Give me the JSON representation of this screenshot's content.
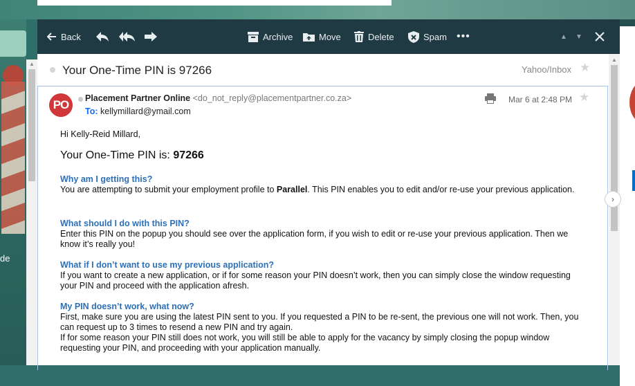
{
  "background": {
    "left_text": "de"
  },
  "toolbar": {
    "back": "Back",
    "archive": "Archive",
    "move": "Move",
    "delete": "Delete",
    "spam": "Spam",
    "more": "•••",
    "prev_arrow": "▲",
    "next_arrow": "▼"
  },
  "email": {
    "subject": "Your One-Time PIN is 97266",
    "folder": "Yahoo/Inbox",
    "avatar_initials": "PO",
    "sender_name": "Placement Partner Online",
    "sender_address": "<do_not_reply@placementpartner.co.za>",
    "to_label": "To:",
    "to_address": "kellymillard@ymail.com",
    "date": "Mar 6 at 2:48 PM",
    "greeting": "Hi Kelly-Reid Millard,",
    "pin_prefix": "Your One-Time PIN is:",
    "pin_value": "97266",
    "sections": [
      {
        "heading": "Why am I getting this?",
        "text_before": "You are attempting to submit your employment profile to ",
        "text_bold": "Parallel",
        "text_after": ". This PIN enables you to edit and/or re-use your previous application."
      },
      {
        "heading": "What should I do with this PIN?",
        "text": "Enter this PIN on the popup you should see over the application form, if you wish to edit or re-use your previous application. Then we know it’s really you!"
      },
      {
        "heading": "What if I don’t want to use my previous application?",
        "text": "If you want to create a new application, or if for some reason your PIN doesn’t work, then you can simply close the window requesting your PIN and proceed with the application afresh."
      },
      {
        "heading": "My PIN doesn’t work, what now?",
        "text1": "First, make sure you are using the latest PIN sent to you. If you requested a PIN to be re-sent, the previous one will not work. Then, you can request up to 3 times to resend a new PIN and try again.",
        "text2": "If for some reason your PIN still does not work, you will still be able to apply for the vacancy by simply closing the popup window requesting your PIN, and proceeding with your application manually."
      }
    ]
  },
  "colors": {
    "toolbar_bg": "#203a43",
    "heading_blue": "#2d70b7",
    "avatar_red": "#d0373a"
  }
}
